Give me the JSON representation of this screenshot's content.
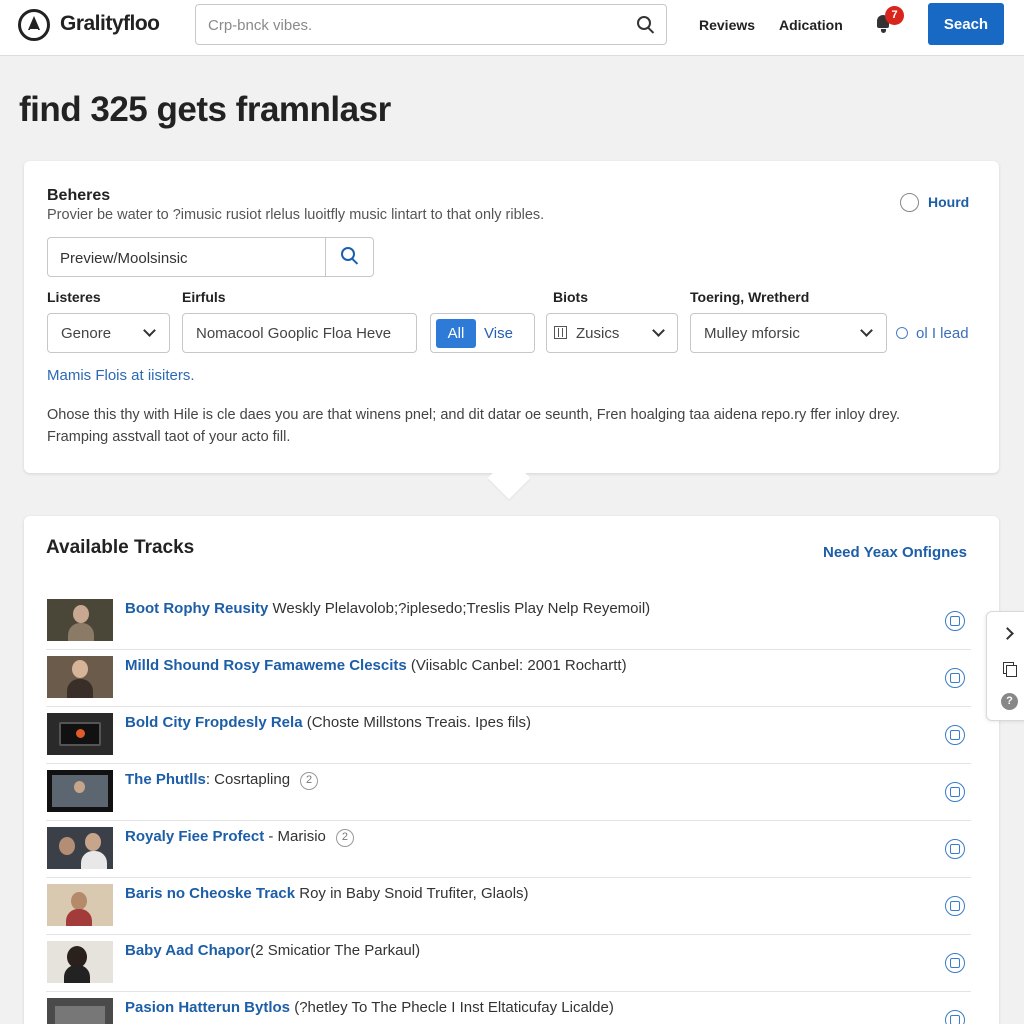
{
  "header": {
    "brand": "Gralityfloo",
    "search_placeholder": "Crp-bnck vibes.",
    "nav": [
      "Reviews",
      "Adication"
    ],
    "notification_count": "7",
    "search_button": "Seach"
  },
  "page_title": "find 325 gets framnlasr",
  "filters": {
    "heading": "Beheres",
    "description": "Provier be water to ?imusic rusiot rlelus luoitfly music lintart to that only ribles.",
    "radio_label": "Hourd",
    "preview_value": "Preview/Moolsinsic",
    "labels": {
      "listeres": "Listeres",
      "eirfuls": "Eirfuls",
      "biots": "Biots",
      "toering": "Toering, Wretherd"
    },
    "genre_select": "Genore",
    "nomacool_input": "Nomacool Gooplic Floa Heve",
    "toggle_all": "All",
    "toggle_vise": "Vise",
    "zusics_select": "Zusics",
    "mulley_select": "Mulley mforsic",
    "lead_link": "ol I lead",
    "marnis_link": "Mamis Flois at iisiters.",
    "paragraph_line1": "Ohose this thy with Hile is cle daes you are that winens pnel; and dit datar oe seunth, Fren hoalging taa aidena repo.ry ffer inloy drey.",
    "paragraph_line2": "Framping asstvall taot of your acto fill."
  },
  "tracks": {
    "title": "Available Tracks",
    "link": "Need Yeax Onfignes",
    "items": [
      {
        "title": "Boot Rophy Reusity",
        "detail": " Weskly Plelavolob;?iplesedo;Treslis Play Nelp Reyemoil)",
        "badge": ""
      },
      {
        "title": "Milld Shound Rosy Famaweme Clescits",
        "detail": " (Viisablc Canbel: 2001 Rochartt)",
        "badge": ""
      },
      {
        "title": "Bold City Fropdesly Rela",
        "detail": " (Choste Millstons Treais. Ipes fils)",
        "badge": ""
      },
      {
        "title": "The Phutlls",
        "detail": ": Cosrtapling",
        "badge": "2"
      },
      {
        "title": "Royaly Fiee Profect",
        "detail": " - Marisio",
        "badge": "2"
      },
      {
        "title": "Baris no Cheoske Track",
        "detail": " Roy in Baby Snoid Trufiter, Glaols)",
        "badge": ""
      },
      {
        "title": "Baby Aad Chapor",
        "detail": "(2 Smicatior The Parkaul)",
        "badge": ""
      },
      {
        "title": "Pasion Hatterun Bytlos",
        "detail": " (?hetley To The Phecle I Inst Eltaticufay Licalde)",
        "badge": ""
      }
    ]
  },
  "colors": {
    "accent": "#1769c4",
    "link": "#1d5ea8",
    "badge": "#d8261c"
  }
}
